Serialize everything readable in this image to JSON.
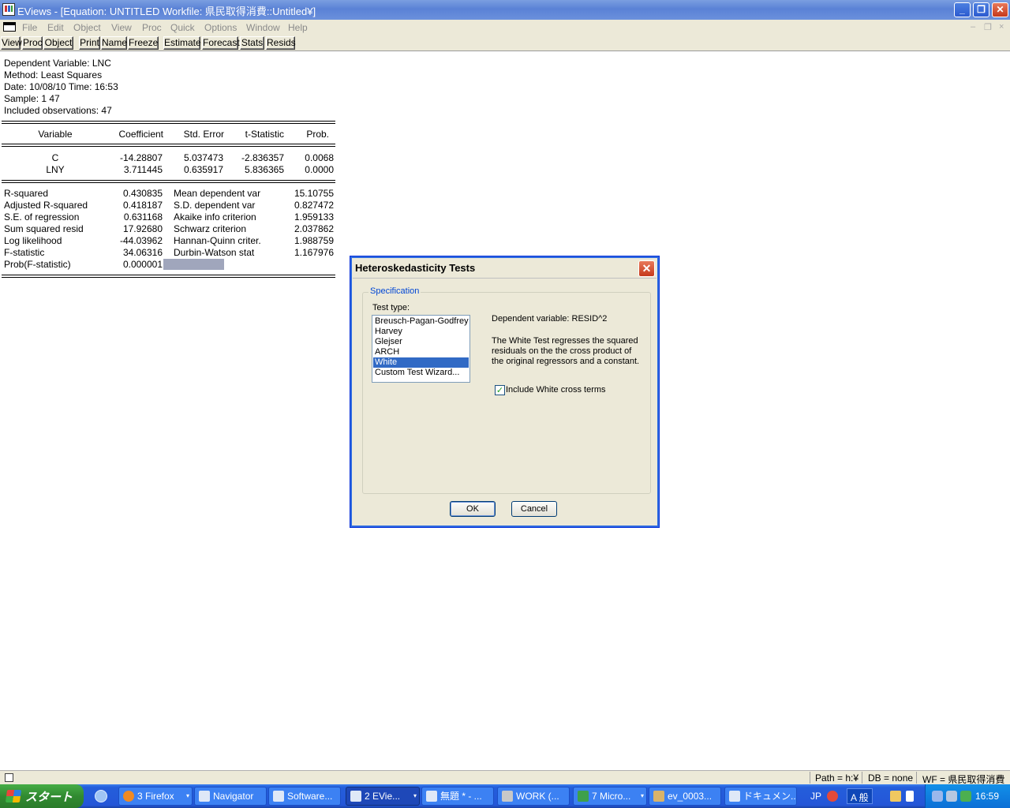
{
  "window": {
    "title": "EViews - [Equation: UNTITLED   Workfile: 県民取得消費::Untitled¥]",
    "minimize": "_",
    "restore": "❐",
    "close": "✕"
  },
  "menu": {
    "items": [
      "File",
      "Edit",
      "Object",
      "View",
      "Proc",
      "Quick",
      "Options",
      "Window",
      "Help"
    ],
    "mdi_minimize": "–",
    "mdi_restore": "❐",
    "mdi_close": "×"
  },
  "toolbar": {
    "buttons": [
      "View",
      "Proc",
      "Object",
      "Print",
      "Name",
      "Freeze",
      "Estimate",
      "Forecast",
      "Stats",
      "Resids"
    ]
  },
  "equation": {
    "header": [
      "Dependent Variable: LNC",
      "Method: Least Squares",
      "Date: 10/08/10   Time: 16:53",
      "Sample: 1 47",
      "Included observations: 47"
    ],
    "columns": [
      "Variable",
      "Coefficient",
      "Std. Error",
      "t-Statistic",
      "Prob."
    ],
    "rows": [
      {
        "variable": "C",
        "coefficient": "-14.28807",
        "std_error": "5.037473",
        "t_stat": "-2.836357",
        "prob": "0.0068"
      },
      {
        "variable": "LNY",
        "coefficient": "3.711445",
        "std_error": "0.635917",
        "t_stat": "5.836365",
        "prob": "0.0000"
      }
    ],
    "stats": [
      {
        "label": "R-squared",
        "value": "0.430835",
        "label2": "Mean dependent var",
        "value2": "15.10755"
      },
      {
        "label": "Adjusted R-squared",
        "value": "0.418187",
        "label2": "S.D. dependent var",
        "value2": "0.827472"
      },
      {
        "label": "S.E. of regression",
        "value": "0.631168",
        "label2": "Akaike info criterion",
        "value2": "1.959133"
      },
      {
        "label": "Sum squared resid",
        "value": "17.92680",
        "label2": "Schwarz criterion",
        "value2": "2.037862"
      },
      {
        "label": "Log likelihood",
        "value": "-44.03962",
        "label2": "Hannan-Quinn criter.",
        "value2": "1.988759"
      },
      {
        "label": "F-statistic",
        "value": "34.06316",
        "label2": "Durbin-Watson stat",
        "value2": "1.167976"
      },
      {
        "label": "Prob(F-statistic)",
        "value": "0.000001",
        "label2": "",
        "value2": ""
      }
    ]
  },
  "dialog": {
    "title": "Heteroskedasticity Tests",
    "close": "✕",
    "group_label": "Specification",
    "test_type_label": "Test type:",
    "test_types": [
      "Breusch-Pagan-Godfrey",
      "Harvey",
      "Glejser",
      "ARCH",
      "White",
      "Custom Test Wizard..."
    ],
    "selected": "White",
    "dependent_variable": "Dependent variable: RESID^2",
    "description": [
      "The White Test regresses the squared",
      "residuals on the the cross product of",
      "the original regressors and a constant."
    ],
    "checkbox_label": "Include White cross terms",
    "checkbox_mark": "✓",
    "checked": true,
    "ok": "OK",
    "cancel": "Cancel"
  },
  "statusbar": {
    "path": "Path = h:¥",
    "db": "DB = none",
    "wf": "WF = 県民取得消費"
  },
  "taskbar": {
    "start": "スタート",
    "tasks": [
      {
        "label": "3 Firefox",
        "arrow": "▾"
      },
      {
        "label": "Navigator",
        "arrow": ""
      },
      {
        "label": "Software...",
        "arrow": ""
      },
      {
        "label": "2 EVie...",
        "arrow": "▾"
      },
      {
        "label": "無題 * - ...",
        "arrow": ""
      },
      {
        "label": "WORK (...",
        "arrow": ""
      },
      {
        "label": "7 Micro...",
        "arrow": "▾"
      },
      {
        "label": "ev_0003...",
        "arrow": ""
      },
      {
        "label": "ドキュメン...",
        "arrow": ""
      }
    ],
    "lang": "JP",
    "ime": "A 般",
    "clock": "16:59"
  },
  "colors": {
    "selection": "#316ac5",
    "titlebar": "#5a82d6",
    "taskbar": "#245edb",
    "start_button": "#318a31"
  }
}
